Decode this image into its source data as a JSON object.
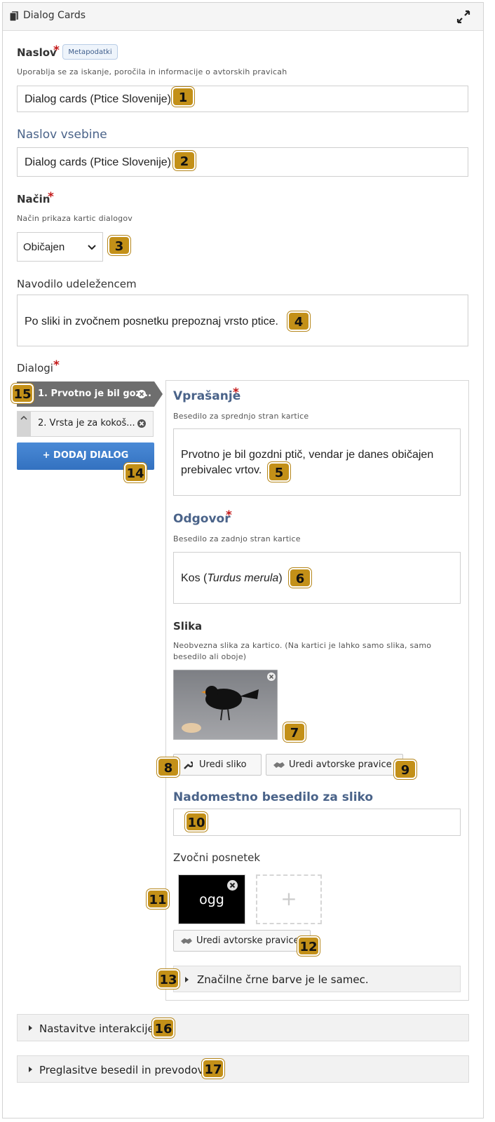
{
  "window": {
    "title": "Dialog Cards"
  },
  "title_field": {
    "label": "Naslov",
    "required_mark": "*",
    "metadata_button": "Metapodatki",
    "description": "Uporablja se za iskanje, poročila in informacije o avtorskih pravicah",
    "value": "Dialog cards (Ptice Slovenije)"
  },
  "content_title": {
    "label": "Naslov vsebine",
    "value": "Dialog cards (Ptice Slovenije)"
  },
  "mode": {
    "label": "Način",
    "required_mark": "*",
    "description": "Način prikaza kartic dialogov",
    "selected": "Običajen"
  },
  "instructions": {
    "label": "Navodilo udeležencem",
    "value": "Po sliki in zvočnem posnetku prepoznaj vrsto ptice."
  },
  "dialogs": {
    "label": "Dialogi",
    "required_mark": "*",
    "items": [
      {
        "label": "1. Prvotno je bil goz..."
      },
      {
        "label": "2. Vrsta je za kokoš..."
      }
    ],
    "add_button": "+ DODAJ DIALOG"
  },
  "dialog_editor": {
    "question": {
      "label": "Vprašanje",
      "required_mark": "*",
      "description": "Besedilo za sprednjo stran kartice",
      "line1": "Prvotno je bil gozdni ptič, vendar je danes običajen",
      "line2": "prebivalec vrtov."
    },
    "answer": {
      "label": "Odgovor",
      "required_mark": "*",
      "description": "Besedilo za zadnjo stran kartice",
      "prefix": "Kos (",
      "italic": "Turdus merula",
      "suffix": ")"
    },
    "image": {
      "label": "Slika",
      "description_line1": "Neobvezna slika za kartico. (Na kartici je lahko samo slika, samo",
      "description_line2": "besedilo ali oboje)",
      "edit_button": "Uredi sliko",
      "copyright_button": "Uredi avtorske pravice"
    },
    "alt_text": {
      "label": "Nadomestno besedilo za sliko",
      "value": ""
    },
    "audio": {
      "label": "Zvočni posnetek",
      "file_label": "ogg",
      "add_symbol": "+",
      "copyright_button": "Uredi avtorske pravice"
    },
    "tip": {
      "label": "Značilne črne barve je le samec."
    }
  },
  "settings": {
    "interaction": "Nastavitve interakcije",
    "overrides": "Preglasitve besedil in prevodov"
  },
  "callouts": [
    "1",
    "2",
    "3",
    "4",
    "5",
    "6",
    "7",
    "8",
    "9",
    "10",
    "11",
    "12",
    "13",
    "14",
    "15",
    "16",
    "17"
  ],
  "colors": {
    "badge": "#c39018",
    "heading_blue": "#4a6389",
    "required_red": "#c31818",
    "add_button": "#3d7dca",
    "active_tab": "#6e6e6e"
  }
}
